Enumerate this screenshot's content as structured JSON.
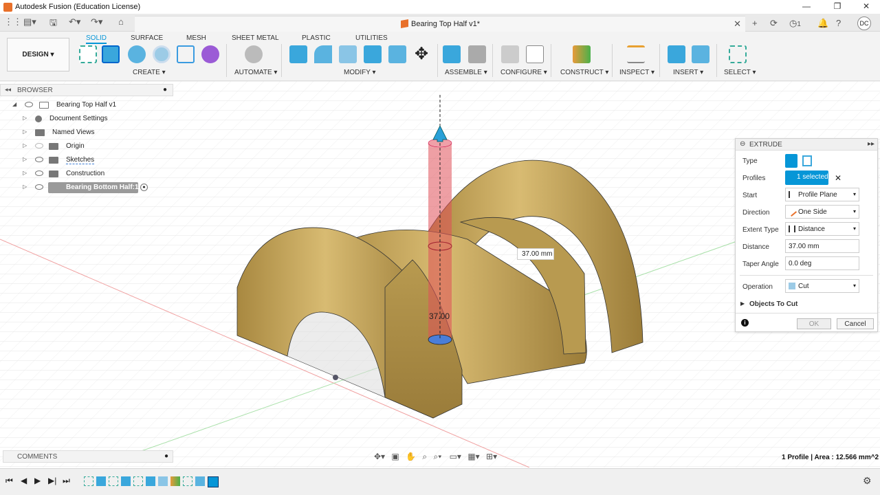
{
  "window": {
    "title": "Autodesk Fusion (Education License)"
  },
  "document": {
    "tab_title": "Bearing Top Half v1*"
  },
  "user": {
    "initials": "DC",
    "job_count": "1"
  },
  "ribbon": {
    "workspace_label": "DESIGN ▾",
    "tabs": [
      "SOLID",
      "SURFACE",
      "MESH",
      "SHEET METAL",
      "PLASTIC",
      "UTILITIES"
    ],
    "groups": [
      "CREATE ▾",
      "AUTOMATE ▾",
      "MODIFY ▾",
      "ASSEMBLE ▾",
      "CONFIGURE ▾",
      "CONSTRUCT ▾",
      "INSPECT ▾",
      "INSERT ▾",
      "SELECT ▾"
    ]
  },
  "browser": {
    "label": "BROWSER",
    "items": [
      {
        "label": "Bearing Top Half v1"
      },
      {
        "label": "Document Settings"
      },
      {
        "label": "Named Views"
      },
      {
        "label": "Origin"
      },
      {
        "label": "Sketches"
      },
      {
        "label": "Construction"
      },
      {
        "label": "Bearing Bottom Half:1"
      }
    ]
  },
  "comments": {
    "label": "COMMENTS"
  },
  "extrude": {
    "title": "EXTRUDE",
    "rows": {
      "type": "Type",
      "profiles": "Profiles",
      "profiles_value": "1 selected",
      "start": "Start",
      "start_value": "Profile Plane",
      "direction": "Direction",
      "direction_value": "One Side",
      "extent_type": "Extent Type",
      "extent_value": "Distance",
      "distance": "Distance",
      "distance_value": "37.00 mm",
      "taper": "Taper Angle",
      "taper_value": "0.0 deg",
      "operation": "Operation",
      "operation_value": "Cut",
      "objects_to_cut": "Objects To Cut"
    },
    "ok": "OK",
    "cancel": "Cancel"
  },
  "viewport": {
    "dimension_input": "37.00 mm",
    "dimension_label": "37.00",
    "status": "1 Profile | Area : 12.566 mm^2"
  },
  "colors": {
    "accent": "#0696d7",
    "part": "#c8a55a",
    "cut_preview": "#e0505a"
  }
}
